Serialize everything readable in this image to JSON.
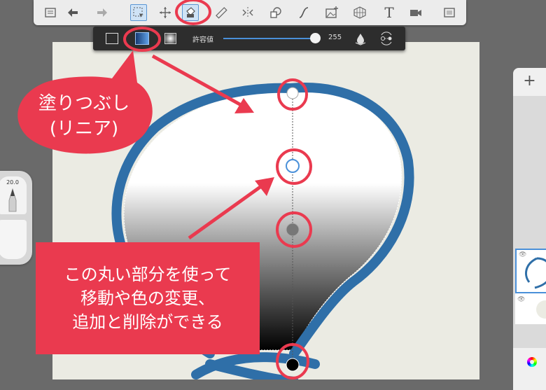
{
  "toolbar": {
    "tools": [
      {
        "name": "layers-list-icon"
      },
      {
        "name": "undo-icon"
      },
      {
        "name": "redo-icon"
      },
      {
        "name": "selection-icon"
      },
      {
        "name": "transform-icon"
      },
      {
        "name": "fill-icon",
        "active": true
      },
      {
        "name": "ruler-icon"
      },
      {
        "name": "symmetry-icon"
      },
      {
        "name": "shapes-icon"
      },
      {
        "name": "curve-icon"
      },
      {
        "name": "image-add-icon"
      },
      {
        "name": "perspective-grid-icon"
      },
      {
        "name": "text-icon",
        "label": "T"
      },
      {
        "name": "video-icon"
      },
      {
        "name": "fullscreen-icon"
      }
    ]
  },
  "fill_options": {
    "modes": [
      "solid",
      "linear",
      "radial"
    ],
    "selected_mode": "linear",
    "tolerance_label": "許容値",
    "tolerance_value": "255"
  },
  "brush": {
    "size": "20.0"
  },
  "layers": {
    "add_label": "+"
  },
  "callouts": {
    "fill_linear": [
      "塗りつぶし",
      "(リニア)"
    ],
    "handles_info": [
      "この丸い部分を使って",
      "移動や色の変更、",
      "追加と削除ができる"
    ]
  },
  "colors": {
    "accent_red": "#ea3a4f",
    "stroke_blue": "#2f6fa8",
    "ui_blue": "#4a90d9",
    "canvas_bg": "#ebebe3"
  }
}
